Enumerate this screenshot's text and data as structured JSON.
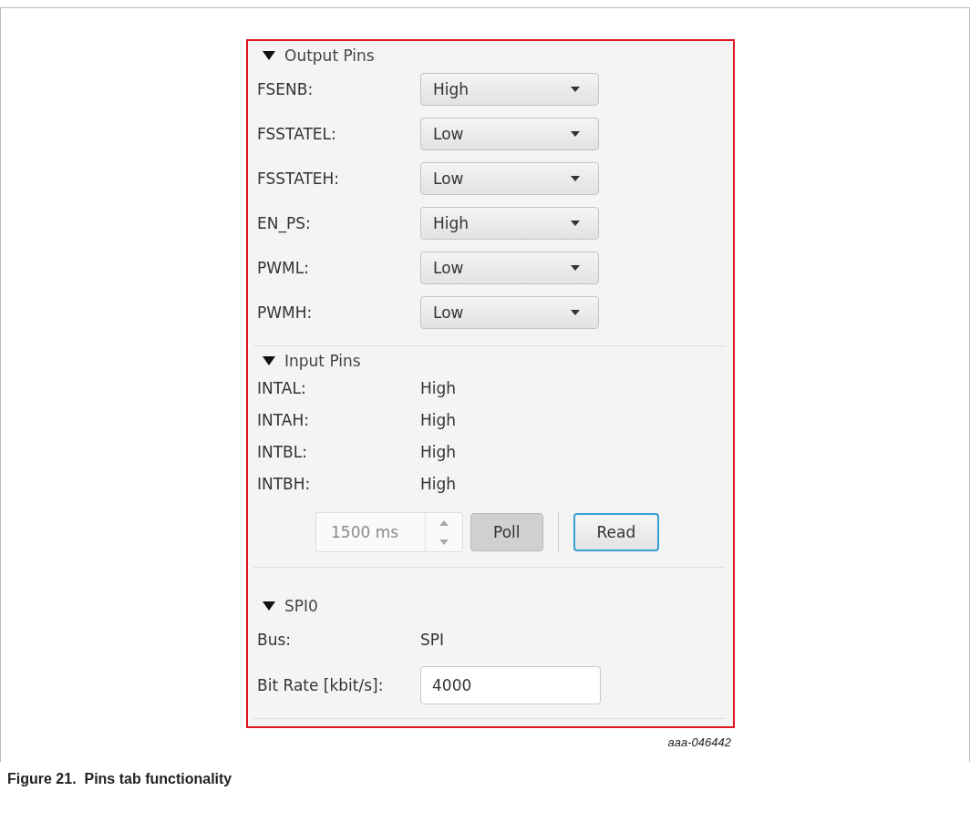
{
  "output_pins": {
    "title": "Output Pins",
    "expanded": true,
    "rows": [
      {
        "label": "FSENB:",
        "value": "High"
      },
      {
        "label": "FSSTATEL:",
        "value": "Low"
      },
      {
        "label": "FSSTATEH:",
        "value": "Low"
      },
      {
        "label": "EN_PS:",
        "value": "High"
      },
      {
        "label": "PWML:",
        "value": "Low"
      },
      {
        "label": "PWMH:",
        "value": "Low"
      }
    ]
  },
  "input_pins": {
    "title": "Input Pins",
    "expanded": true,
    "rows": [
      {
        "label": "INTAL:",
        "value": "High"
      },
      {
        "label": "INTAH:",
        "value": "High"
      },
      {
        "label": "INTBL:",
        "value": "High"
      },
      {
        "label": "INTBH:",
        "value": "High"
      }
    ],
    "interval": {
      "value": "1500 ms",
      "disabled": true
    },
    "poll_button": {
      "label": "Poll",
      "selected": true
    },
    "read_button": {
      "label": "Read",
      "focused": true
    }
  },
  "spi0": {
    "title": "SPI0",
    "expanded": true,
    "bus_label": "Bus:",
    "bus_value": "SPI",
    "bit_rate_label": "Bit Rate [kbit/s]:",
    "bit_rate_value": "4000"
  },
  "figure_id": "aaa-046442",
  "caption": "Figure 21.  Pins tab functionality"
}
